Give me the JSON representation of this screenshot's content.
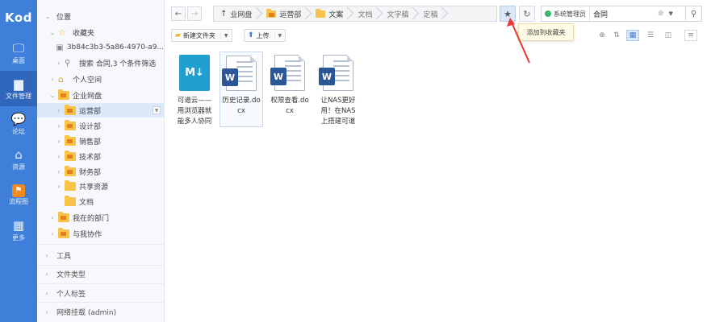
{
  "app": {
    "logo": "Kod"
  },
  "rail": [
    {
      "icon": "🖵",
      "label": "桌面"
    },
    {
      "icon": "▆",
      "label": "文件管理"
    },
    {
      "icon": "💬",
      "label": "论坛"
    },
    {
      "icon": "⌂",
      "label": "资源"
    },
    {
      "icon": "⚑",
      "label": "流程图"
    },
    {
      "icon": "▦",
      "label": "更多"
    }
  ],
  "tree": {
    "location": "位置",
    "favorites": "收藏夹",
    "fav_item": "3b84c3b3-5a86-4970-a9...",
    "search_item": "搜索 合同,3 个条件筛选",
    "personal": "个人空间",
    "enterprise": "企业网盘",
    "departments": [
      "运营部",
      "设计部",
      "销售部",
      "技术部",
      "财务部",
      "共享资源",
      "文档"
    ],
    "my_dept": "我在的部门",
    "collab": "与我协作",
    "sections": [
      "工具",
      "文件类型",
      "个人标签",
      "网络挂载 (admin)"
    ]
  },
  "breadcrumbs": [
    {
      "label": "业网盘",
      "icon": "up-icon"
    },
    {
      "label": "运营部",
      "icon": "folder-icon"
    },
    {
      "label": "文案",
      "icon": "folder-icon"
    },
    {
      "label": "文档",
      "icon": ""
    },
    {
      "label": "文字稿",
      "icon": ""
    },
    {
      "label": "定稿",
      "icon": ""
    }
  ],
  "search": {
    "scope": "系统管理员",
    "value": "合同"
  },
  "toolbar": {
    "new_folder": "新建文件夹",
    "upload": "上传"
  },
  "tooltip": "添加到收藏夹",
  "files": [
    {
      "name": "可道云——用浏览器就能多人协同",
      "type": "md",
      "badge": "M↓"
    },
    {
      "name": "历史记录.docx",
      "type": "docx",
      "badge": "W"
    },
    {
      "name": "权限查看.docx",
      "type": "docx",
      "badge": "W"
    },
    {
      "name": "让NAS更好用！在NAS上搭建可道",
      "type": "docx",
      "badge": "W"
    }
  ],
  "colors": {
    "rail": "#3f7fd9",
    "rail_active": "#2f67bd",
    "annotation": "#e53935",
    "word": "#2b5797",
    "markdown": "#1f9fcf"
  }
}
